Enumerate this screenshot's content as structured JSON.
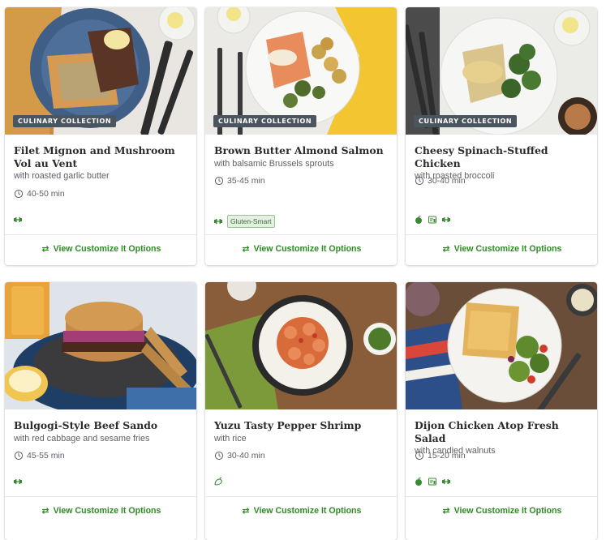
{
  "cards": [
    {
      "title": "Filet Mignon and Mushroom Vol au Vent",
      "subtitle": "with roasted garlic butter",
      "badge": "Culinary Collection",
      "time": "40-50 min",
      "tags": [
        "protein-icon"
      ],
      "pill": "",
      "cta": "View Customize It Options"
    },
    {
      "title": "Brown Butter Almond Salmon",
      "subtitle": "with balsamic Brussels sprouts",
      "badge": "Culinary Collection",
      "time": "35-45 min",
      "tags": [
        "protein-icon"
      ],
      "pill": "Gluten-Smart",
      "cta": "View Customize It Options"
    },
    {
      "title": "Cheesy Spinach-Stuffed Chicken",
      "subtitle": "with roasted broccoli",
      "badge": "Culinary Collection",
      "time": "30-40 min",
      "tags": [
        "apple-icon",
        "calorie-icon",
        "protein-icon"
      ],
      "pill": "",
      "cta": "View Customize It Options"
    },
    {
      "title": "Bulgogi-Style Beef Sando",
      "subtitle": "with red cabbage and sesame fries",
      "badge": "",
      "time": "45-55 min",
      "tags": [
        "protein-icon"
      ],
      "pill": "",
      "cta": "View Customize It Options"
    },
    {
      "title": "Yuzu Tasty Pepper Shrimp",
      "subtitle": "with rice",
      "badge": "",
      "time": "30-40 min",
      "tags": [
        "spicy-icon"
      ],
      "pill": "",
      "cta": "View Customize It Options"
    },
    {
      "title": "Dijon Chicken Atop Fresh Salad",
      "subtitle": "with candied walnuts",
      "badge": "",
      "time": "15-20 min",
      "tags": [
        "apple-icon",
        "calorie-icon",
        "protein-icon"
      ],
      "pill": "",
      "cta": "View Customize It Options"
    }
  ],
  "colors": {
    "accent": "#2e8b24",
    "badge": "#4b5560",
    "icon_green": "#3b8a33"
  }
}
